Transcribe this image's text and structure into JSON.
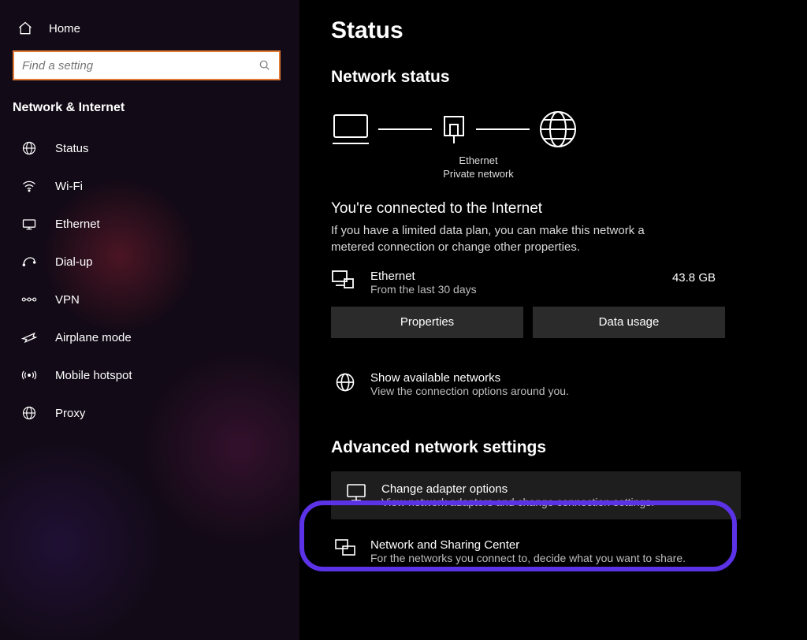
{
  "sidebar": {
    "home_label": "Home",
    "search_placeholder": "Find a setting",
    "category": "Network & Internet",
    "items": [
      {
        "label": "Status"
      },
      {
        "label": "Wi-Fi"
      },
      {
        "label": "Ethernet"
      },
      {
        "label": "Dial-up"
      },
      {
        "label": "VPN"
      },
      {
        "label": "Airplane mode"
      },
      {
        "label": "Mobile hotspot"
      },
      {
        "label": "Proxy"
      }
    ]
  },
  "main": {
    "page_title": "Status",
    "section_title": "Network status",
    "diagram": {
      "device_label": "Ethernet",
      "network_type": "Private network"
    },
    "connected": {
      "title": "You're connected to the Internet",
      "desc": "If you have a limited data plan, you can make this network a metered connection or change other properties."
    },
    "usage": {
      "connection_name": "Ethernet",
      "period": "From the last 30 days",
      "amount": "43.8 GB",
      "properties_btn": "Properties",
      "datausage_btn": "Data usage"
    },
    "available": {
      "title": "Show available networks",
      "desc": "View the connection options around you."
    },
    "advanced_heading": "Advanced network settings",
    "adapter": {
      "title": "Change adapter options",
      "desc": "View network adapters and change connection settings."
    },
    "sharing": {
      "title": "Network and Sharing Center",
      "desc": "For the networks you connect to, decide what you want to share."
    }
  }
}
